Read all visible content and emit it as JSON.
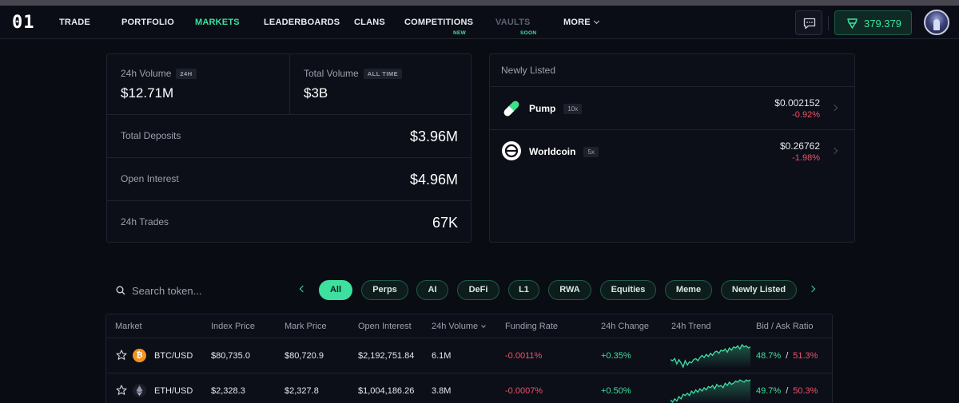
{
  "nav": {
    "logo": "01",
    "items": [
      "TRADE",
      "PORTFOLIO",
      "MARKETS",
      "LEADERBOARDS",
      "CLANS",
      "COMPETITIONS",
      "VAULTS",
      "MORE"
    ],
    "active": "MARKETS",
    "tags": {
      "competitions": "NEW",
      "vaults": "SOON"
    },
    "balance": "379.379"
  },
  "stats": {
    "volume_24h": {
      "label": "24h Volume",
      "badge": "24H",
      "value": "$12.71M"
    },
    "total_volume": {
      "label": "Total Volume",
      "badge": "ALL TIME",
      "value": "$3B"
    },
    "rows": [
      {
        "label": "Total Deposits",
        "value": "$3.96M"
      },
      {
        "label": "Open Interest",
        "value": "$4.96M"
      },
      {
        "label": "24h Trades",
        "value": "67K"
      }
    ]
  },
  "newly_listed": {
    "title": "Newly Listed",
    "items": [
      {
        "name": "Pump",
        "leverage": "10x",
        "price": "$0.002152",
        "change": "-0.92%",
        "icon": "pill-icon"
      },
      {
        "name": "Worldcoin",
        "leverage": "5x",
        "price": "$0.26762",
        "change": "-1.98%",
        "icon": "worldcoin-icon"
      }
    ]
  },
  "filters": {
    "search_placeholder": "Search token...",
    "categories": [
      "All",
      "Perps",
      "AI",
      "DeFi",
      "L1",
      "RWA",
      "Equities",
      "Meme",
      "Newly Listed"
    ],
    "active": "All"
  },
  "table": {
    "headers": [
      "Market",
      "Index Price",
      "Mark Price",
      "Open Interest",
      "24h Volume",
      "Funding Rate",
      "24h Change",
      "24h Trend",
      "Bid / Ask Ratio"
    ],
    "rows": [
      {
        "market": "BTC/USD",
        "index_price": "$80,735.0",
        "mark_price": "$80,720.9",
        "open_interest": "$2,192,751.84",
        "volume_24h": "6.1M",
        "funding_rate": "-0.0011%",
        "change_24h": "+0.35%",
        "bid": "48.7%",
        "sep": "/",
        "ask": "51.3%",
        "trend": [
          12,
          11,
          13,
          8,
          12,
          9,
          5,
          11,
          7,
          10,
          9,
          12,
          13,
          11,
          14,
          16,
          14,
          17,
          15,
          18,
          16,
          19,
          20,
          18,
          21,
          20,
          22,
          19,
          23,
          21,
          24,
          23,
          25,
          22,
          26,
          24,
          25,
          23,
          24
        ]
      },
      {
        "market": "ETH/USD",
        "index_price": "$2,328.3",
        "mark_price": "$2,327.8",
        "open_interest": "$1,004,186.26",
        "volume_24h": "3.8M",
        "funding_rate": "-0.0007%",
        "change_24h": "+0.50%",
        "bid": "49.7%",
        "sep": "/",
        "ask": "50.3%",
        "trend": [
          8,
          6,
          9,
          7,
          11,
          9,
          13,
          12,
          14,
          12,
          16,
          14,
          17,
          15,
          18,
          16,
          19,
          17,
          20,
          19,
          21,
          18,
          22,
          20,
          21,
          19,
          23,
          21,
          24,
          22,
          23,
          25,
          24,
          26,
          25,
          24,
          26,
          25,
          26
        ]
      }
    ]
  },
  "colors": {
    "accent": "#3ee0a0",
    "negative": "#f0556a",
    "background": "#0a0c14"
  }
}
